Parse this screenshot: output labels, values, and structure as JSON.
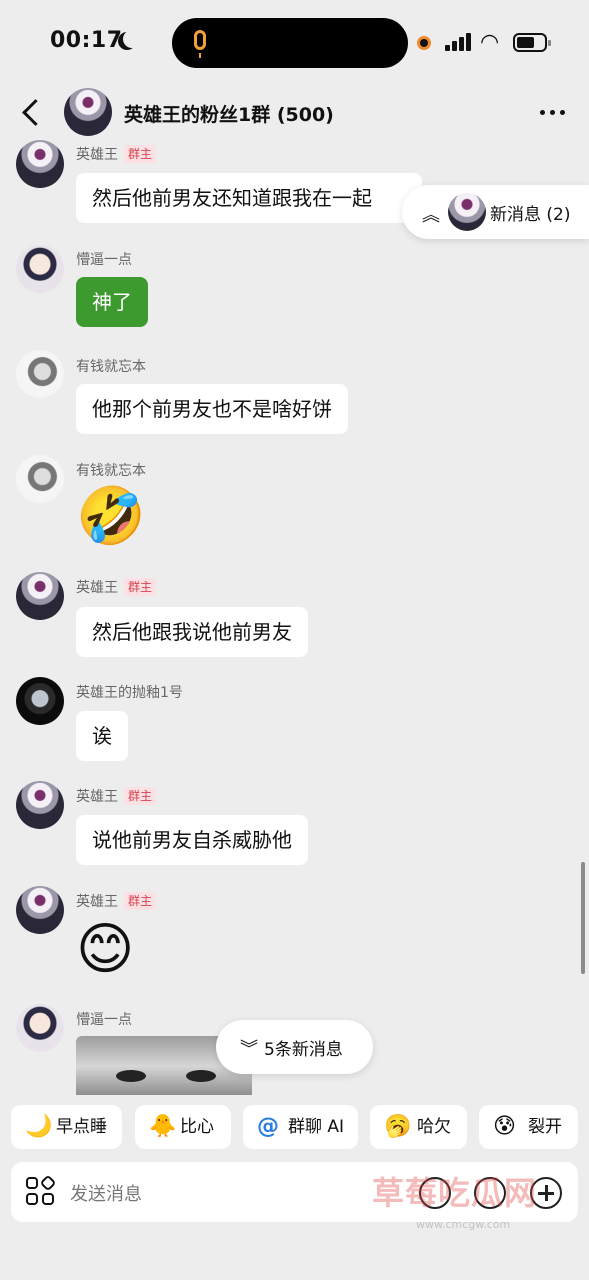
{
  "status_bar": {
    "time": "00:17"
  },
  "header": {
    "title": "英雄王的粉丝1群 (500)"
  },
  "new_messages_top": {
    "label": "新消息 (2)"
  },
  "badge_label": "群主",
  "messages": [
    {
      "sender": "英雄王",
      "is_owner": true,
      "text": "然后他前男友还知道跟我在一起"
    },
    {
      "sender": "懵逼一点",
      "is_owner": false,
      "text": "神了"
    },
    {
      "sender": "有钱就忘本",
      "is_owner": false,
      "text": "他那个前男友也不是啥好饼"
    },
    {
      "sender": "有钱就忘本",
      "is_owner": false,
      "emoji": "🤣"
    },
    {
      "sender": "英雄王",
      "is_owner": true,
      "text": "然后他跟我说他前男友"
    },
    {
      "sender": "英雄王的抛釉1号",
      "is_owner": false,
      "text": "诶"
    },
    {
      "sender": "英雄王",
      "is_owner": true,
      "text": "说他前男友自杀威胁他"
    },
    {
      "sender": "英雄王",
      "is_owner": true,
      "emoji": "😊"
    },
    {
      "sender": "懵逼一点",
      "is_owner": false,
      "image": "cat-photo"
    }
  ],
  "new_messages_bottom": {
    "label": "5条新消息"
  },
  "quick_replies": [
    {
      "icon": "🌙",
      "label": "早点睡"
    },
    {
      "icon": "🐥",
      "label": "比心"
    },
    {
      "icon": "@",
      "label": "群聊 AI"
    },
    {
      "icon": "🥱",
      "label": "哈欠"
    },
    {
      "icon": "😰",
      "label": "裂开"
    }
  ],
  "input": {
    "placeholder": "发送消息"
  },
  "watermark": {
    "text": "草莓吃瓜网",
    "sub": "www.cmcgw.com"
  }
}
